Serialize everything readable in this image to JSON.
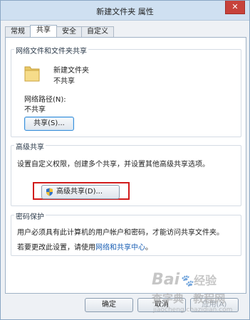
{
  "window": {
    "title": "新建文件夹 属性",
    "close_symbol": "✕"
  },
  "tabs": [
    {
      "label": "常规",
      "active": false
    },
    {
      "label": "共享",
      "active": true
    },
    {
      "label": "安全",
      "active": false
    },
    {
      "label": "自定义",
      "active": false
    }
  ],
  "network_sharing": {
    "group_title": "网络文件和文件夹共享",
    "folder_name": "新建文件夹",
    "folder_status": "不共享",
    "path_label": "网络路径(N):",
    "path_value": "不共享",
    "share_button": "共享(S)..."
  },
  "advanced_sharing": {
    "group_title": "高级共享",
    "description": "设置自定义权限，创建多个共享，并设置其他高级共享选项。",
    "button": "高级共享(D)...",
    "button_icon": "shield-icon",
    "highlight_color": "#d11a1a"
  },
  "password_protection": {
    "group_title": "密码保护",
    "description": "用户必须具有此计算机的用户帐户和密码，才能访问共享文件夹。",
    "change_text": "若要更改此设置，请使用",
    "link_text": "网络和共享中心",
    "link_suffix": "。"
  },
  "footer": {
    "ok_button": "确定",
    "cancel_button": "取消",
    "apply_button": "应用(A)"
  },
  "watermark": {
    "brand": "Bai",
    "brand_suffix": "经验",
    "sub": "查字典",
    "sub2": "教程网",
    "url": "jiaocheng.chazidian.com"
  },
  "colors": {
    "titlebar": "#cfe0f1",
    "close": "#c7423b",
    "link": "#1a5fb4",
    "accent_red": "#d11a1a"
  }
}
